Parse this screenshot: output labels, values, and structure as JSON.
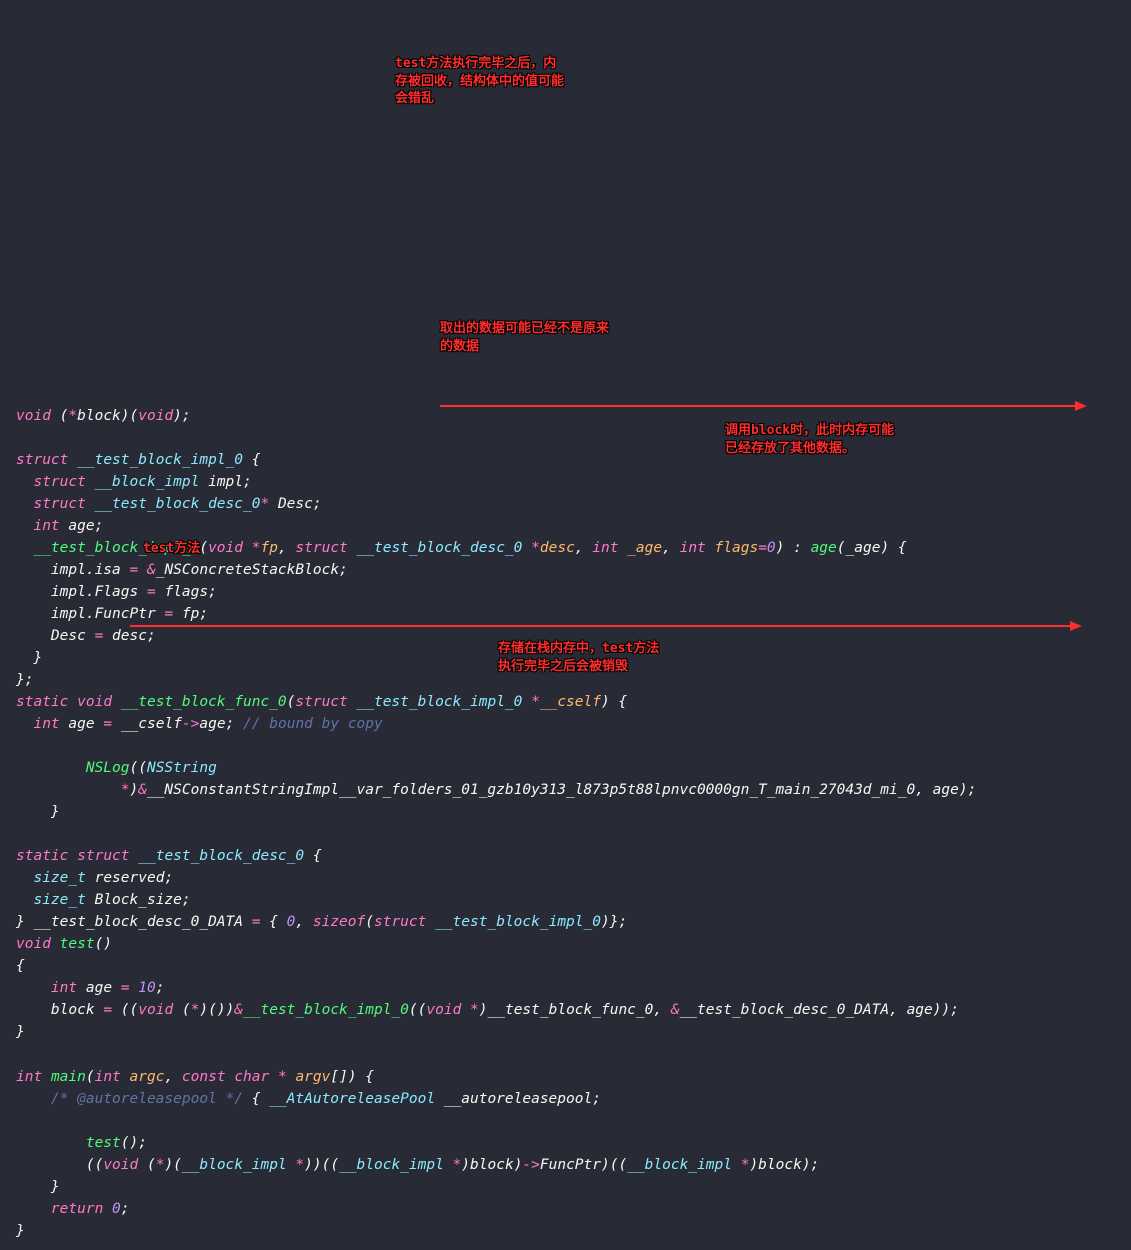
{
  "code_lines": [
    [
      {
        "c": "kw",
        "t": "void"
      },
      {
        "c": "punc",
        "t": " ("
      },
      {
        "c": "op",
        "t": "*"
      },
      {
        "c": "id",
        "t": "block"
      },
      {
        "c": "punc",
        "t": ")("
      },
      {
        "c": "kw",
        "t": "void"
      },
      {
        "c": "punc",
        "t": ");"
      }
    ],
    [],
    [
      {
        "c": "kw",
        "t": "struct"
      },
      {
        "c": "punc",
        "t": " "
      },
      {
        "c": "type",
        "t": "__test_block_impl_0"
      },
      {
        "c": "punc",
        "t": " {"
      }
    ],
    [
      {
        "c": "punc",
        "t": "  "
      },
      {
        "c": "kw",
        "t": "struct"
      },
      {
        "c": "punc",
        "t": " "
      },
      {
        "c": "type",
        "t": "__block_impl"
      },
      {
        "c": "punc",
        "t": " "
      },
      {
        "c": "id",
        "t": "impl"
      },
      {
        "c": "punc",
        "t": ";"
      }
    ],
    [
      {
        "c": "punc",
        "t": "  "
      },
      {
        "c": "kw",
        "t": "struct"
      },
      {
        "c": "punc",
        "t": " "
      },
      {
        "c": "type",
        "t": "__test_block_desc_0"
      },
      {
        "c": "op",
        "t": "*"
      },
      {
        "c": "punc",
        "t": " "
      },
      {
        "c": "id",
        "t": "Desc"
      },
      {
        "c": "punc",
        "t": ";"
      }
    ],
    [
      {
        "c": "punc",
        "t": "  "
      },
      {
        "c": "kw",
        "t": "int"
      },
      {
        "c": "punc",
        "t": " "
      },
      {
        "c": "id",
        "t": "age"
      },
      {
        "c": "punc",
        "t": ";"
      }
    ],
    [
      {
        "c": "punc",
        "t": "  "
      },
      {
        "c": "fn",
        "t": "__test_block_impl_0"
      },
      {
        "c": "punc",
        "t": "("
      },
      {
        "c": "kw",
        "t": "void"
      },
      {
        "c": "punc",
        "t": " "
      },
      {
        "c": "op",
        "t": "*"
      },
      {
        "c": "param",
        "t": "fp"
      },
      {
        "c": "punc",
        "t": ", "
      },
      {
        "c": "kw",
        "t": "struct"
      },
      {
        "c": "punc",
        "t": " "
      },
      {
        "c": "type",
        "t": "__test_block_desc_0"
      },
      {
        "c": "punc",
        "t": " "
      },
      {
        "c": "op",
        "t": "*"
      },
      {
        "c": "param",
        "t": "desc"
      },
      {
        "c": "punc",
        "t": ", "
      },
      {
        "c": "kw",
        "t": "int"
      },
      {
        "c": "punc",
        "t": " "
      },
      {
        "c": "param",
        "t": "_age"
      },
      {
        "c": "punc",
        "t": ", "
      },
      {
        "c": "kw",
        "t": "int"
      },
      {
        "c": "punc",
        "t": " "
      },
      {
        "c": "param",
        "t": "flags"
      },
      {
        "c": "op",
        "t": "="
      },
      {
        "c": "num",
        "t": "0"
      },
      {
        "c": "punc",
        "t": ") : "
      },
      {
        "c": "fn",
        "t": "age"
      },
      {
        "c": "punc",
        "t": "("
      },
      {
        "c": "id",
        "t": "_age"
      },
      {
        "c": "punc",
        "t": ") {"
      }
    ],
    [
      {
        "c": "punc",
        "t": "    "
      },
      {
        "c": "id",
        "t": "impl"
      },
      {
        "c": "punc",
        "t": "."
      },
      {
        "c": "id",
        "t": "isa"
      },
      {
        "c": "punc",
        "t": " "
      },
      {
        "c": "op",
        "t": "="
      },
      {
        "c": "punc",
        "t": " "
      },
      {
        "c": "op",
        "t": "&"
      },
      {
        "c": "id",
        "t": "_NSConcreteStackBlock"
      },
      {
        "c": "punc",
        "t": ";"
      }
    ],
    [
      {
        "c": "punc",
        "t": "    "
      },
      {
        "c": "id",
        "t": "impl"
      },
      {
        "c": "punc",
        "t": "."
      },
      {
        "c": "id",
        "t": "Flags"
      },
      {
        "c": "punc",
        "t": " "
      },
      {
        "c": "op",
        "t": "="
      },
      {
        "c": "punc",
        "t": " "
      },
      {
        "c": "id",
        "t": "flags"
      },
      {
        "c": "punc",
        "t": ";"
      }
    ],
    [
      {
        "c": "punc",
        "t": "    "
      },
      {
        "c": "id",
        "t": "impl"
      },
      {
        "c": "punc",
        "t": "."
      },
      {
        "c": "id",
        "t": "FuncPtr"
      },
      {
        "c": "punc",
        "t": " "
      },
      {
        "c": "op",
        "t": "="
      },
      {
        "c": "punc",
        "t": " "
      },
      {
        "c": "id",
        "t": "fp"
      },
      {
        "c": "punc",
        "t": ";"
      }
    ],
    [
      {
        "c": "punc",
        "t": "    "
      },
      {
        "c": "id",
        "t": "Desc"
      },
      {
        "c": "punc",
        "t": " "
      },
      {
        "c": "op",
        "t": "="
      },
      {
        "c": "punc",
        "t": " "
      },
      {
        "c": "id",
        "t": "desc"
      },
      {
        "c": "punc",
        "t": ";"
      }
    ],
    [
      {
        "c": "punc",
        "t": "  }"
      }
    ],
    [
      {
        "c": "punc",
        "t": "};"
      }
    ],
    [
      {
        "c": "kw",
        "t": "static"
      },
      {
        "c": "punc",
        "t": " "
      },
      {
        "c": "kw",
        "t": "void"
      },
      {
        "c": "punc",
        "t": " "
      },
      {
        "c": "fn",
        "t": "__test_block_func_0"
      },
      {
        "c": "punc",
        "t": "("
      },
      {
        "c": "kw",
        "t": "struct"
      },
      {
        "c": "punc",
        "t": " "
      },
      {
        "c": "type",
        "t": "__test_block_impl_0"
      },
      {
        "c": "punc",
        "t": " "
      },
      {
        "c": "op",
        "t": "*"
      },
      {
        "c": "param",
        "t": "__cself"
      },
      {
        "c": "punc",
        "t": ") {"
      }
    ],
    [
      {
        "c": "punc",
        "t": "  "
      },
      {
        "c": "kw",
        "t": "int"
      },
      {
        "c": "punc",
        "t": " "
      },
      {
        "c": "id",
        "t": "age"
      },
      {
        "c": "punc",
        "t": " "
      },
      {
        "c": "op",
        "t": "="
      },
      {
        "c": "punc",
        "t": " "
      },
      {
        "c": "id",
        "t": "__cself"
      },
      {
        "c": "op",
        "t": "->"
      },
      {
        "c": "id",
        "t": "age"
      },
      {
        "c": "punc",
        "t": "; "
      },
      {
        "c": "cmt",
        "t": "// bound by copy"
      }
    ],
    [],
    [
      {
        "c": "punc",
        "t": "        "
      },
      {
        "c": "fn",
        "t": "NSLog"
      },
      {
        "c": "punc",
        "t": "(("
      },
      {
        "c": "type",
        "t": "NSString"
      }
    ],
    [
      {
        "c": "punc",
        "t": "            "
      },
      {
        "c": "op",
        "t": "*"
      },
      {
        "c": "punc",
        "t": ")"
      },
      {
        "c": "op",
        "t": "&"
      },
      {
        "c": "id",
        "t": "__NSConstantStringImpl__var_folders_01_gzb10y313_l873p5t88lpnvc0000gn_T_main_27043d_mi_0"
      },
      {
        "c": "punc",
        "t": ", "
      },
      {
        "c": "id",
        "t": "age"
      },
      {
        "c": "punc",
        "t": ");"
      }
    ],
    [
      {
        "c": "punc",
        "t": "    }"
      }
    ],
    [],
    [
      {
        "c": "kw",
        "t": "static"
      },
      {
        "c": "punc",
        "t": " "
      },
      {
        "c": "kw",
        "t": "struct"
      },
      {
        "c": "punc",
        "t": " "
      },
      {
        "c": "type",
        "t": "__test_block_desc_0"
      },
      {
        "c": "punc",
        "t": " {"
      }
    ],
    [
      {
        "c": "punc",
        "t": "  "
      },
      {
        "c": "type",
        "t": "size_t"
      },
      {
        "c": "punc",
        "t": " "
      },
      {
        "c": "id",
        "t": "reserved"
      },
      {
        "c": "punc",
        "t": ";"
      }
    ],
    [
      {
        "c": "punc",
        "t": "  "
      },
      {
        "c": "type",
        "t": "size_t"
      },
      {
        "c": "punc",
        "t": " "
      },
      {
        "c": "id",
        "t": "Block_size"
      },
      {
        "c": "punc",
        "t": ";"
      }
    ],
    [
      {
        "c": "punc",
        "t": "} "
      },
      {
        "c": "id",
        "t": "__test_block_desc_0_DATA"
      },
      {
        "c": "punc",
        "t": " "
      },
      {
        "c": "op",
        "t": "="
      },
      {
        "c": "punc",
        "t": " { "
      },
      {
        "c": "num",
        "t": "0"
      },
      {
        "c": "punc",
        "t": ", "
      },
      {
        "c": "kw",
        "t": "sizeof"
      },
      {
        "c": "punc",
        "t": "("
      },
      {
        "c": "kw",
        "t": "struct"
      },
      {
        "c": "punc",
        "t": " "
      },
      {
        "c": "type",
        "t": "__test_block_impl_0"
      },
      {
        "c": "punc",
        "t": ")};"
      }
    ],
    [
      {
        "c": "kw",
        "t": "void"
      },
      {
        "c": "punc",
        "t": " "
      },
      {
        "c": "fn",
        "t": "test"
      },
      {
        "c": "punc",
        "t": "()"
      }
    ],
    [
      {
        "c": "punc",
        "t": "{"
      }
    ],
    [
      {
        "c": "punc",
        "t": "    "
      },
      {
        "c": "kw",
        "t": "int"
      },
      {
        "c": "punc",
        "t": " "
      },
      {
        "c": "id",
        "t": "age"
      },
      {
        "c": "punc",
        "t": " "
      },
      {
        "c": "op",
        "t": "="
      },
      {
        "c": "punc",
        "t": " "
      },
      {
        "c": "num",
        "t": "10"
      },
      {
        "c": "punc",
        "t": ";"
      }
    ],
    [
      {
        "c": "punc",
        "t": "    "
      },
      {
        "c": "id",
        "t": "block"
      },
      {
        "c": "punc",
        "t": " "
      },
      {
        "c": "op",
        "t": "="
      },
      {
        "c": "punc",
        "t": " (("
      },
      {
        "c": "kw",
        "t": "void"
      },
      {
        "c": "punc",
        "t": " ("
      },
      {
        "c": "op",
        "t": "*"
      },
      {
        "c": "punc",
        "t": ")())"
      },
      {
        "c": "op",
        "t": "&"
      },
      {
        "c": "fn",
        "t": "__test_block_impl_0"
      },
      {
        "c": "punc",
        "t": "(("
      },
      {
        "c": "kw",
        "t": "void"
      },
      {
        "c": "punc",
        "t": " "
      },
      {
        "c": "op",
        "t": "*"
      },
      {
        "c": "punc",
        "t": ")"
      },
      {
        "c": "id",
        "t": "__test_block_func_0"
      },
      {
        "c": "punc",
        "t": ", "
      },
      {
        "c": "op",
        "t": "&"
      },
      {
        "c": "id",
        "t": "__test_block_desc_0_DATA"
      },
      {
        "c": "punc",
        "t": ", "
      },
      {
        "c": "id",
        "t": "age"
      },
      {
        "c": "punc",
        "t": "));"
      }
    ],
    [
      {
        "c": "punc",
        "t": "}"
      }
    ],
    [],
    [
      {
        "c": "kw",
        "t": "int"
      },
      {
        "c": "punc",
        "t": " "
      },
      {
        "c": "fn",
        "t": "main"
      },
      {
        "c": "punc",
        "t": "("
      },
      {
        "c": "kw",
        "t": "int"
      },
      {
        "c": "punc",
        "t": " "
      },
      {
        "c": "param",
        "t": "argc"
      },
      {
        "c": "punc",
        "t": ", "
      },
      {
        "c": "kw",
        "t": "const"
      },
      {
        "c": "punc",
        "t": " "
      },
      {
        "c": "kw",
        "t": "char"
      },
      {
        "c": "punc",
        "t": " "
      },
      {
        "c": "op",
        "t": "*"
      },
      {
        "c": "punc",
        "t": " "
      },
      {
        "c": "param",
        "t": "argv"
      },
      {
        "c": "punc",
        "t": "[]) {"
      }
    ],
    [
      {
        "c": "punc",
        "t": "    "
      },
      {
        "c": "cmt",
        "t": "/* @autoreleasepool */"
      },
      {
        "c": "punc",
        "t": " { "
      },
      {
        "c": "type",
        "t": "__AtAutoreleasePool"
      },
      {
        "c": "punc",
        "t": " "
      },
      {
        "c": "id",
        "t": "__autoreleasepool"
      },
      {
        "c": "punc",
        "t": ";"
      }
    ],
    [],
    [
      {
        "c": "punc",
        "t": "        "
      },
      {
        "c": "fn",
        "t": "test"
      },
      {
        "c": "punc",
        "t": "();"
      }
    ],
    [
      {
        "c": "punc",
        "t": "        (("
      },
      {
        "c": "kw",
        "t": "void"
      },
      {
        "c": "punc",
        "t": " ("
      },
      {
        "c": "op",
        "t": "*"
      },
      {
        "c": "punc",
        "t": ")("
      },
      {
        "c": "type",
        "t": "__block_impl"
      },
      {
        "c": "punc",
        "t": " "
      },
      {
        "c": "op",
        "t": "*"
      },
      {
        "c": "punc",
        "t": "))(("
      },
      {
        "c": "type",
        "t": "__block_impl"
      },
      {
        "c": "punc",
        "t": " "
      },
      {
        "c": "op",
        "t": "*"
      },
      {
        "c": "punc",
        "t": ")"
      },
      {
        "c": "id",
        "t": "block"
      },
      {
        "c": "punc",
        "t": ")"
      },
      {
        "c": "op",
        "t": "->"
      },
      {
        "c": "id",
        "t": "FuncPtr"
      },
      {
        "c": "punc",
        "t": ")(("
      },
      {
        "c": "type",
        "t": "__block_impl"
      },
      {
        "c": "punc",
        "t": " "
      },
      {
        "c": "op",
        "t": "*"
      },
      {
        "c": "punc",
        "t": ")"
      },
      {
        "c": "id",
        "t": "block"
      },
      {
        "c": "punc",
        "t": ");"
      }
    ],
    [
      {
        "c": "punc",
        "t": "    }"
      }
    ],
    [
      {
        "c": "punc",
        "t": "    "
      },
      {
        "c": "kw",
        "t": "return"
      },
      {
        "c": "punc",
        "t": " "
      },
      {
        "c": "num",
        "t": "0"
      },
      {
        "c": "punc",
        "t": ";"
      }
    ],
    [
      {
        "c": "punc",
        "t": "}"
      }
    ]
  ],
  "annotations": {
    "a1": "test方法执行完毕之后，内存被回收，结构体中的值可能会错乱",
    "a2": "取出的数据可能已经不是原来的数据",
    "a3": "调用block时，此时内存可能已经存放了其他数据。",
    "a4": "test方法",
    "a5": "存储在栈内存中，test方法执行完毕之后会被销毁"
  }
}
